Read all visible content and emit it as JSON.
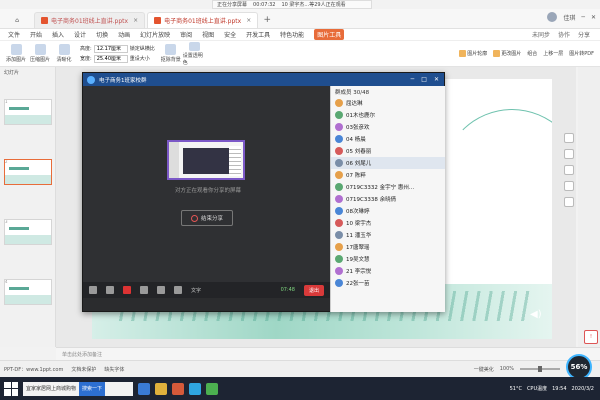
{
  "share_status": {
    "label": "正在分享屏幕",
    "time": "00:07:32",
    "viewers": "10 梁宇杰...等29人正在观看"
  },
  "tabs": [
    {
      "label": "电子商务01班线上直讲.pptx"
    },
    {
      "label": "电子商务01班线上直讲.pptx"
    }
  ],
  "window_controls": {
    "user": "佳琪",
    "minimize": "─",
    "close": "✕"
  },
  "menu": {
    "items": [
      "文件",
      "开始",
      "插入",
      "设计",
      "切换",
      "动画",
      "幻灯片放映",
      "审阅",
      "视图",
      "安全",
      "开发工具",
      "特色功能",
      "图片工具"
    ],
    "active_index": 12,
    "right": [
      "未同步",
      "协作",
      "分享"
    ]
  },
  "ribbon": {
    "tools": [
      "添加图片",
      "压缩图片",
      "清晰化",
      "抠除背景",
      "设置透明色"
    ],
    "height_label": "高度:",
    "height_value": "12.17厘米",
    "width_label": "宽度:",
    "width_value": "25.40厘米",
    "lock_label": "锁定纵横比",
    "reset_label": "重设大小",
    "right": [
      "图片轮廓",
      "更改图片",
      "组合",
      "上移一层",
      "图片转PDF",
      "图片效果",
      "重设图片",
      "对齐",
      "下移一层"
    ]
  },
  "slides_panel": {
    "tab": "幻灯片",
    "numbers": [
      "1",
      "2",
      "3",
      "4"
    ]
  },
  "qq": {
    "title": "电子商务1班家校群",
    "controls": [
      "─",
      "□",
      "✕"
    ],
    "share_note": "对方正在观看你分享的屏幕",
    "end_share": "结束分享",
    "toolbar": [
      "麦克风",
      "扬声器",
      "摄像头",
      "分享",
      "更多",
      "新消息",
      "文字"
    ],
    "signal": "07:48",
    "exit": "退出",
    "members_head": "群成员 30/48",
    "members": [
      "屈达琳",
      "01木也鹿尔",
      "03张彦欢",
      "04 杨晨",
      "05 刘春丽",
      "06 刘尾儿",
      "07 陈粹",
      "0719C3332 金宇宁 惠州...",
      "0719C3338 余晓倩",
      "08次琳婷",
      "10 梁宇杰",
      "11 潘玉华",
      "17唐翠瑶",
      "19吴文慧",
      "21 李宗悦",
      "22张一苗"
    ],
    "highlight_index": 5
  },
  "notes_placeholder": "单击此处添加备注",
  "status": {
    "left": [
      "PPT-DF：www.1ppt.com",
      "文档未保护",
      "缺失字体"
    ],
    "smart": "一键美化",
    "zoom": "100%",
    "speed": "56%"
  },
  "taskbar": {
    "search_text": "宜家家居网上商城购物",
    "search_btn": "搜索一下",
    "weather": "51°C",
    "cpu": "CPU温度",
    "time": "19:54",
    "date": "2020/3/2"
  }
}
